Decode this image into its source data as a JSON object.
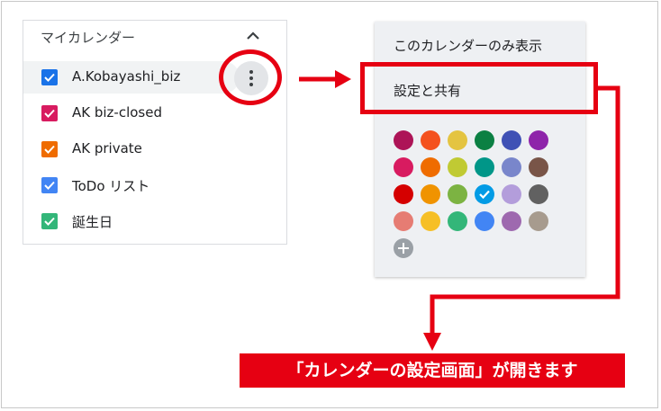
{
  "my_calendars": {
    "header": "マイカレンダー",
    "items": [
      {
        "label": "A.Kobayashi_biz",
        "color": "#1a73e8"
      },
      {
        "label": "AK biz-closed",
        "color": "#d81b60"
      },
      {
        "label": "AK private",
        "color": "#ef6c00"
      },
      {
        "label": "ToDo リスト",
        "color": "#4285f4"
      },
      {
        "label": "誕生日",
        "color": "#33b679"
      }
    ]
  },
  "menu": {
    "item1": "このカレンダーのみ表示",
    "item2": "設定と共有",
    "colors": [
      "#ad1457",
      "#f4511e",
      "#e4c441",
      "#0b8043",
      "#3f51b5",
      "#8e24aa",
      "#d81b60",
      "#ef6c00",
      "#c0ca33",
      "#009688",
      "#7986cb",
      "#795548",
      "#d50000",
      "#f09300",
      "#7cb342",
      "#039be5",
      "#b39ddb",
      "#616161",
      "#e67c73",
      "#f6bf26",
      "#33b679",
      "#4285f4",
      "#9e69af",
      "#a79b8e"
    ],
    "selected_color": "#039be5"
  },
  "annotation": {
    "caption": "「カレンダーの設定画面」が開きます",
    "accent": "#e60012"
  }
}
